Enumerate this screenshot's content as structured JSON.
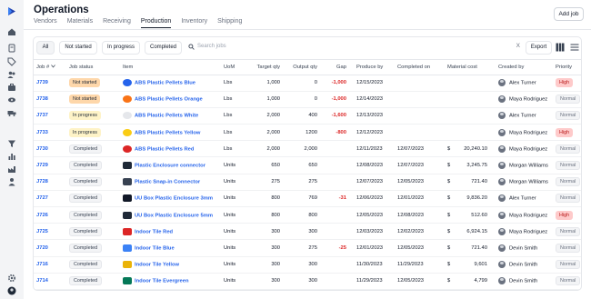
{
  "app": {
    "title": "Operations",
    "add_job_label": "Add job"
  },
  "tabs": [
    {
      "label": "Vendors",
      "active": false
    },
    {
      "label": "Materials",
      "active": false
    },
    {
      "label": "Receiving",
      "active": false
    },
    {
      "label": "Production",
      "active": true
    },
    {
      "label": "Inventory",
      "active": false
    },
    {
      "label": "Shipping",
      "active": false
    }
  ],
  "filters": {
    "all": "All",
    "not_started": "Not started",
    "in_progress": "In progress",
    "completed": "Completed",
    "search_placeholder": "Search jobs",
    "clear": "X",
    "export": "Export"
  },
  "columns": [
    "Job #",
    "Job status",
    "Item",
    "UoM",
    "Target qty",
    "Output qty",
    "Gap",
    "Produce by",
    "Completed on",
    "Material cost",
    "Created by",
    "Priority"
  ],
  "rows": [
    {
      "job": "J739",
      "status": "Not started",
      "item": "ABS Plastic Pellets Blue",
      "thumb": "#2563eb",
      "uom": "Lbs",
      "target": "1,000",
      "output": "0",
      "gap": "-1,000",
      "produce_by": "12/15/2023",
      "completed_on": "",
      "cost_sym": "",
      "cost": "",
      "created_by": "Alex Turner",
      "priority": "High"
    },
    {
      "job": "J738",
      "status": "Not started",
      "item": "ABS Plastic Pellets Orange",
      "thumb": "#f97316",
      "uom": "Lbs",
      "target": "1,000",
      "output": "0",
      "gap": "-1,000",
      "produce_by": "12/14/2023",
      "completed_on": "",
      "cost_sym": "",
      "cost": "",
      "created_by": "Maya Rodriguez",
      "priority": "Normal"
    },
    {
      "job": "J737",
      "status": "In progress",
      "item": "ABS Plastic Pellets White",
      "thumb": "#e5e7eb",
      "uom": "Lbs",
      "target": "2,000",
      "output": "400",
      "gap": "-1,600",
      "produce_by": "12/13/2023",
      "completed_on": "",
      "cost_sym": "",
      "cost": "",
      "created_by": "Alex Turner",
      "priority": "Normal"
    },
    {
      "job": "J733",
      "status": "In progress",
      "item": "ABS Plastic Pellets Yellow",
      "thumb": "#facc15",
      "uom": "Lbs",
      "target": "2,000",
      "output": "1200",
      "gap": "-800",
      "produce_by": "12/12/2023",
      "completed_on": "",
      "cost_sym": "",
      "cost": "",
      "created_by": "Maya Rodriguez",
      "priority": "High"
    },
    {
      "job": "J730",
      "status": "Completed",
      "item": "ABS Plastic Pellets Red",
      "thumb": "#dc2626",
      "uom": "Lbs",
      "target": "2,000",
      "output": "2,000",
      "gap": "",
      "produce_by": "12/11/2023",
      "completed_on": "12/07/2023",
      "cost_sym": "$",
      "cost": "20,240.10",
      "created_by": "Maya Rodriguez",
      "priority": "Normal"
    },
    {
      "job": "J729",
      "status": "Completed",
      "item": "Plastic Enclosure connector",
      "thumb": "#1f2937",
      "uom": "Units",
      "target": "650",
      "output": "650",
      "gap": "",
      "produce_by": "12/08/2023",
      "completed_on": "12/07/2023",
      "cost_sym": "$",
      "cost": "3,245.75",
      "created_by": "Morgan Williams",
      "priority": "Normal"
    },
    {
      "job": "J728",
      "status": "Completed",
      "item": "Plastic Snap-in Connector",
      "thumb": "#374151",
      "uom": "Units",
      "target": "275",
      "output": "275",
      "gap": "",
      "produce_by": "12/07/2023",
      "completed_on": "12/05/2023",
      "cost_sym": "$",
      "cost": "721.40",
      "created_by": "Morgan Williams",
      "priority": "Normal"
    },
    {
      "job": "J727",
      "status": "Completed",
      "item": "UU Box Plastic Enclosure 3mm",
      "thumb": "#111827",
      "uom": "Units",
      "target": "800",
      "output": "769",
      "gap": "-31",
      "produce_by": "12/06/2023",
      "completed_on": "12/01/2023",
      "cost_sym": "$",
      "cost": "9,836.20",
      "created_by": "Alex Turner",
      "priority": "Normal"
    },
    {
      "job": "J726",
      "status": "Completed",
      "item": "UU Box Plastic Enclosure 5mm",
      "thumb": "#1f2937",
      "uom": "Units",
      "target": "800",
      "output": "800",
      "gap": "",
      "produce_by": "12/05/2023",
      "completed_on": "12/08/2023",
      "cost_sym": "$",
      "cost": "512.60",
      "created_by": "Maya Rodriguez",
      "priority": "High"
    },
    {
      "job": "J725",
      "status": "Completed",
      "item": "Indoor Tile Red",
      "thumb": "#dc2626",
      "uom": "Units",
      "target": "300",
      "output": "300",
      "gap": "",
      "produce_by": "12/03/2023",
      "completed_on": "12/02/2023",
      "cost_sym": "$",
      "cost": "6,924.15",
      "created_by": "Maya Rodriguez",
      "priority": "Normal"
    },
    {
      "job": "J720",
      "status": "Completed",
      "item": "Indoor Tile Blue",
      "thumb": "#3b82f6",
      "uom": "Units",
      "target": "300",
      "output": "275",
      "gap": "-25",
      "produce_by": "12/01/2023",
      "completed_on": "12/05/2023",
      "cost_sym": "$",
      "cost": "721.40",
      "created_by": "Devin Smith",
      "priority": "Normal"
    },
    {
      "job": "J716",
      "status": "Completed",
      "item": "Indoor Tile Yellow",
      "thumb": "#eab308",
      "uom": "Units",
      "target": "300",
      "output": "300",
      "gap": "",
      "produce_by": "11/30/2023",
      "completed_on": "11/29/2023",
      "cost_sym": "$",
      "cost": "9,601",
      "created_by": "Devin Smith",
      "priority": "Normal"
    },
    {
      "job": "J714",
      "status": "Completed",
      "item": "Indoor Tile Evergreen",
      "thumb": "#047857",
      "uom": "Units",
      "target": "300",
      "output": "300",
      "gap": "",
      "produce_by": "11/29/2023",
      "completed_on": "12/05/2023",
      "cost_sym": "$",
      "cost": "4,799",
      "created_by": "Devin Smith",
      "priority": "Normal"
    }
  ],
  "colors": {
    "accent": "#2563eb",
    "danger": "#dc2626",
    "not_started": "#fed7aa",
    "in_progress": "#fef3c7"
  }
}
